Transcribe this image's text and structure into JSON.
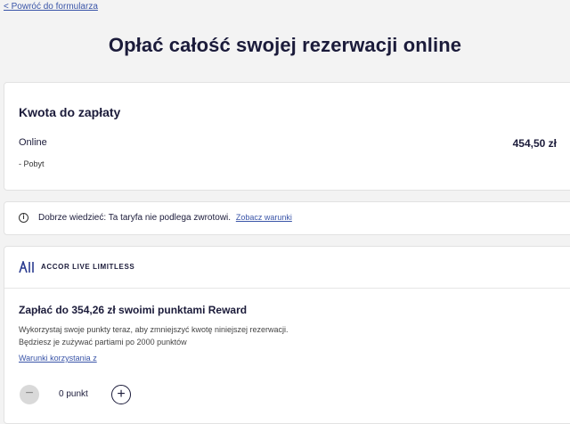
{
  "nav": {
    "back_label": "< Powróć do formularza"
  },
  "page": {
    "title": "Opłać całość swojej rezerwacji online"
  },
  "amount": {
    "heading": "Kwota do zapłaty",
    "row_label": "Online",
    "row_sub": "- Pobyt",
    "price": "454,50 zł"
  },
  "info": {
    "text": "Dobrze wiedzieć: Ta taryfa nie podlega zwrotowi.",
    "link": "Zobacz warunki"
  },
  "reward": {
    "brand": "ACCOR LIVE LIMITLESS",
    "title": "Zapłać do 354,26 zł swoimi punktami Reward",
    "desc_line1": "Wykorzystaj swoje punkty teraz, aby zmniejszyć kwotę niniejszej rezerwacji.",
    "desc_line2": "Będziesz je zużywać partiami po 2000 punktów",
    "terms_link": "Warunki korzystania z",
    "points_value": "0 punkt",
    "minus_symbol": "−",
    "plus_symbol": "+"
  },
  "colors": {
    "link": "#3a55a8",
    "text": "#1b1b3a",
    "background": "#f3f3f3"
  },
  "icons": {
    "info": "info-icon",
    "brand_logo": "all-logo-icon"
  }
}
